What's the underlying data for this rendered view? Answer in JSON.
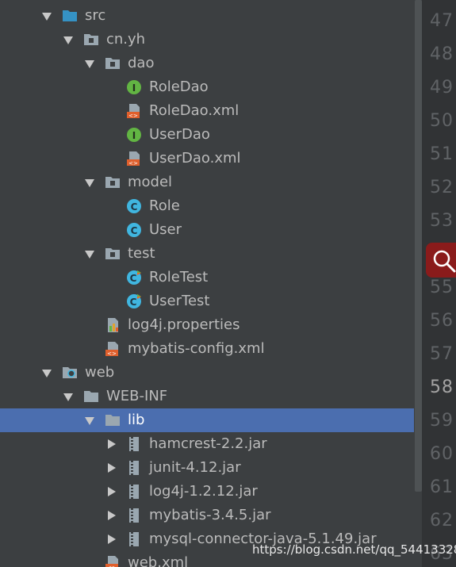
{
  "tree": [
    {
      "label": "src",
      "icon": "folder-source-icon",
      "arrow": "down",
      "indent": 0,
      "selected": false
    },
    {
      "label": "cn.yh",
      "icon": "package-icon",
      "arrow": "down",
      "indent": 1,
      "selected": false
    },
    {
      "label": "dao",
      "icon": "package-icon",
      "arrow": "down",
      "indent": 2,
      "selected": false
    },
    {
      "label": "RoleDao",
      "icon": "interface-icon",
      "arrow": "",
      "indent": 3,
      "selected": false
    },
    {
      "label": "RoleDao.xml",
      "icon": "xml-file-icon",
      "arrow": "",
      "indent": 3,
      "selected": false
    },
    {
      "label": "UserDao",
      "icon": "interface-icon",
      "arrow": "",
      "indent": 3,
      "selected": false
    },
    {
      "label": "UserDao.xml",
      "icon": "xml-file-icon",
      "arrow": "",
      "indent": 3,
      "selected": false
    },
    {
      "label": "model",
      "icon": "package-icon",
      "arrow": "down",
      "indent": 2,
      "selected": false
    },
    {
      "label": "Role",
      "icon": "class-icon",
      "arrow": "",
      "indent": 3,
      "selected": false
    },
    {
      "label": "User",
      "icon": "class-icon",
      "arrow": "",
      "indent": 3,
      "selected": false
    },
    {
      "label": "test",
      "icon": "package-icon",
      "arrow": "down",
      "indent": 2,
      "selected": false
    },
    {
      "label": "RoleTest",
      "icon": "test-class-icon",
      "arrow": "",
      "indent": 3,
      "selected": false
    },
    {
      "label": "UserTest",
      "icon": "test-class-icon",
      "arrow": "",
      "indent": 3,
      "selected": false
    },
    {
      "label": "log4j.properties",
      "icon": "properties-file-icon",
      "arrow": "",
      "indent": 2,
      "selected": false
    },
    {
      "label": "mybatis-config.xml",
      "icon": "xml-file-icon",
      "arrow": "",
      "indent": 2,
      "selected": false
    },
    {
      "label": "web",
      "icon": "web-folder-icon",
      "arrow": "down",
      "indent": 0,
      "selected": false
    },
    {
      "label": "WEB-INF",
      "icon": "folder-icon",
      "arrow": "down",
      "indent": 1,
      "selected": false
    },
    {
      "label": "lib",
      "icon": "folder-icon",
      "arrow": "down",
      "indent": 2,
      "selected": true
    },
    {
      "label": "hamcrest-2.2.jar",
      "icon": "jar-icon",
      "arrow": "right",
      "indent": 3,
      "selected": false
    },
    {
      "label": "junit-4.12.jar",
      "icon": "jar-icon",
      "arrow": "right",
      "indent": 3,
      "selected": false
    },
    {
      "label": "log4j-1.2.12.jar",
      "icon": "jar-icon",
      "arrow": "right",
      "indent": 3,
      "selected": false
    },
    {
      "label": "mybatis-3.4.5.jar",
      "icon": "jar-icon",
      "arrow": "right",
      "indent": 3,
      "selected": false
    },
    {
      "label": "mysql-connector-java-5.1.49.jar",
      "icon": "jar-icon",
      "arrow": "right",
      "indent": 3,
      "selected": false
    },
    {
      "label": "web.xml",
      "icon": "xml-file-icon",
      "arrow": "",
      "indent": 2,
      "selected": false
    }
  ],
  "gutter": {
    "lines": [
      "47",
      "48",
      "49",
      "50",
      "51",
      "52",
      "53",
      "54",
      "55",
      "56",
      "57",
      "58",
      "59",
      "60",
      "61",
      "62",
      "63"
    ],
    "current": "58"
  },
  "watermark": "https://blog.csdn.net/qq_54413328",
  "colors": {
    "background": "#3c3f41",
    "selection": "#4b6eaf",
    "gutter": "#313335",
    "search_badge": "#8a1b1b"
  }
}
